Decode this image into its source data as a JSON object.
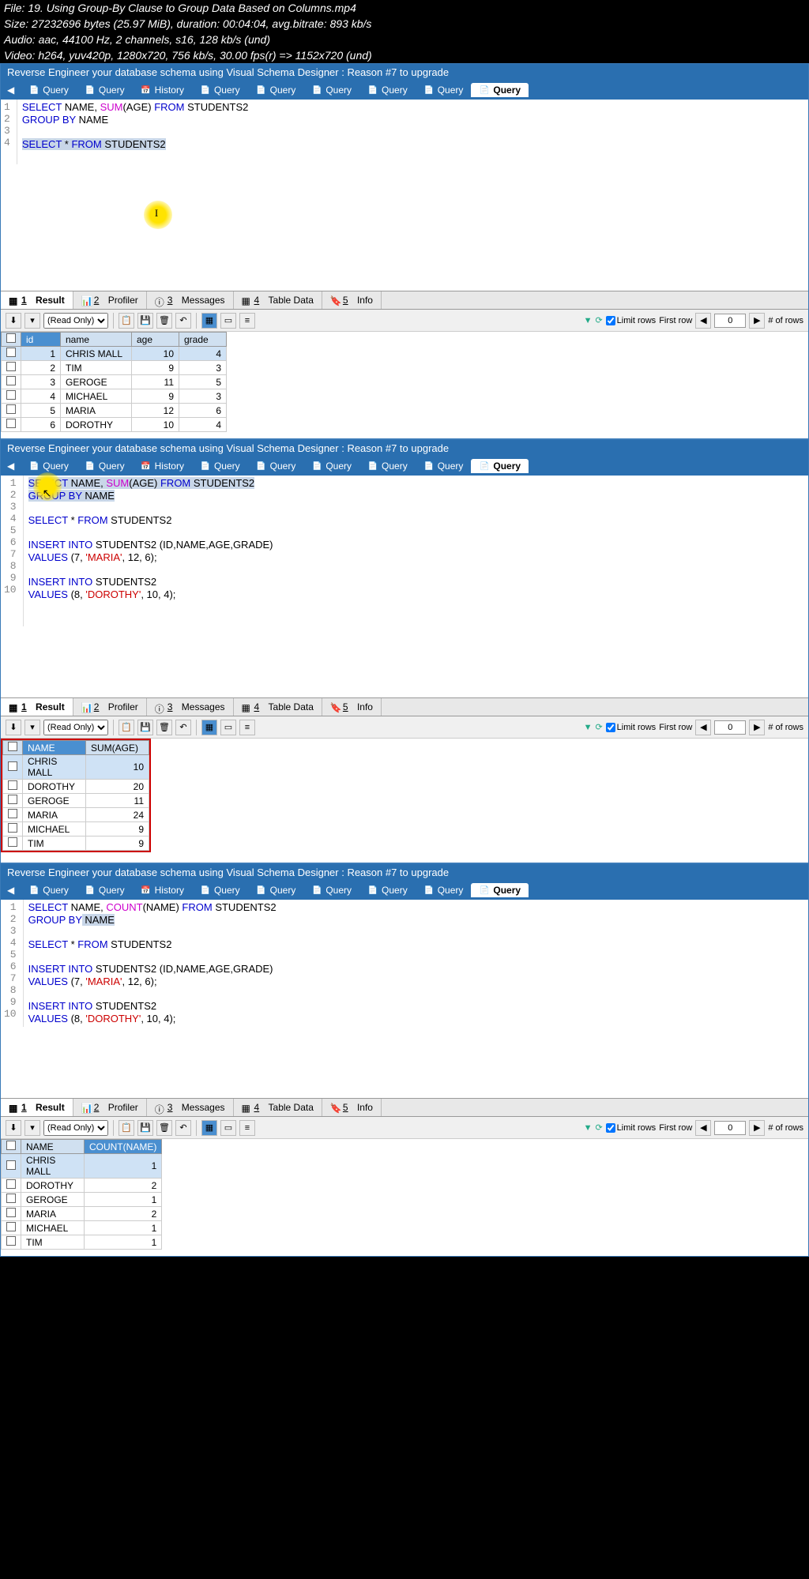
{
  "file_info": {
    "file": "File: 19. Using Group-By Clause to Group Data Based on Columns.mp4",
    "size": "Size: 27232696 bytes (25.97 MiB), duration: 00:04:04, avg.bitrate: 893 kb/s",
    "audio": "Audio: aac, 44100 Hz, 2 channels, s16, 128 kb/s (und)",
    "video": "Video: h264, yuv420p, 1280x720, 756 kb/s, 30.00 fps(r) => 1152x720 (und)"
  },
  "banner": "Reverse Engineer your database schema using Visual Schema Designer : Reason #7 to upgrade",
  "tabs": {
    "query": "Query",
    "history": "History"
  },
  "result_tabs": {
    "result": "Result",
    "profiler": "Profiler",
    "messages": "Messages",
    "table_data": "Table Data",
    "info": "Info"
  },
  "toolbar": {
    "readonly": "(Read Only)",
    "limit_rows": "Limit rows",
    "first_row": "First row",
    "first_row_val": "0",
    "num_rows": "# of rows"
  },
  "panel1": {
    "code": {
      "l1": {
        "select": "SELECT",
        "name": " NAME, ",
        "sum": "SUM",
        "rest": "(AGE) ",
        "from": "FROM",
        "tbl": " STUDENTS2"
      },
      "l2": {
        "group": "GROUP BY",
        "rest": " NAME"
      },
      "l4": {
        "select": "SELECT",
        "star": " * ",
        "from": "FROM",
        "tbl": " STUDENTS2"
      }
    },
    "cols": [
      "id",
      "name",
      "age",
      "grade"
    ],
    "rows": [
      {
        "id": "1",
        "name": "CHRIS MALL",
        "age": "10",
        "grade": "4"
      },
      {
        "id": "2",
        "name": "TIM",
        "age": "9",
        "grade": "3"
      },
      {
        "id": "3",
        "name": "GEROGE",
        "age": "11",
        "grade": "5"
      },
      {
        "id": "4",
        "name": "MICHAEL",
        "age": "9",
        "grade": "3"
      },
      {
        "id": "5",
        "name": "MARIA",
        "age": "12",
        "grade": "6"
      },
      {
        "id": "6",
        "name": "DOROTHY",
        "age": "10",
        "grade": "4"
      }
    ]
  },
  "panel2": {
    "code": {
      "l1": {
        "select": "SELECT",
        "name": " NAME, ",
        "sum": "SUM",
        "rest": "(AGE) ",
        "from": "FROM",
        "tbl": " STUDENTS2"
      },
      "l2": {
        "group": "GROUP BY",
        "rest": " NAME"
      },
      "l4": {
        "select": "SELECT",
        "star": " * ",
        "from": "FROM",
        "tbl": " STUDENTS2"
      },
      "l6": {
        "insert": "INSERT INTO",
        "tbl": " STUDENTS2 (ID,NAME,AGE,GRADE)"
      },
      "l7": {
        "values": "VALUES",
        "rest1": " (7, ",
        "str": "'MARIA'",
        "rest2": ", 12, 6);"
      },
      "l9": {
        "insert": "INSERT INTO",
        "tbl": " STUDENTS2"
      },
      "l10": {
        "values": "VALUES",
        "rest1": " (8, ",
        "str": "'DOROTHY'",
        "rest2": ", 10, 4);"
      }
    },
    "cols": [
      "NAME",
      "SUM(AGE)"
    ],
    "rows": [
      {
        "name": "CHRIS MALL",
        "sum": "10"
      },
      {
        "name": "DOROTHY",
        "sum": "20"
      },
      {
        "name": "GEROGE",
        "sum": "11"
      },
      {
        "name": "MARIA",
        "sum": "24"
      },
      {
        "name": "MICHAEL",
        "sum": "9"
      },
      {
        "name": "TIM",
        "sum": "9"
      }
    ]
  },
  "panel3": {
    "code": {
      "l1": {
        "select": "SELECT",
        "name": " NAME, ",
        "count": "COUNT",
        "rest": "(NAME) ",
        "from": "FROM",
        "tbl": " STUDENTS2"
      },
      "l2": {
        "group": "GROUP BY",
        "name": " NAME"
      },
      "l4": {
        "select": "SELECT",
        "star": " * ",
        "from": "FROM",
        "tbl": " STUDENTS2"
      },
      "l6": {
        "insert": "INSERT INTO",
        "tbl": " STUDENTS2 (ID,NAME,AGE,GRADE)"
      },
      "l7": {
        "values": "VALUES",
        "rest1": " (7, ",
        "str": "'MARIA'",
        "rest2": ", 12, 6);"
      },
      "l9": {
        "insert": "INSERT INTO",
        "tbl": " STUDENTS2"
      },
      "l10": {
        "values": "VALUES",
        "rest1": " (8, ",
        "str": "'DOROTHY'",
        "rest2": ", 10, 4);"
      }
    },
    "cols": [
      "NAME",
      "COUNT(NAME)"
    ],
    "rows": [
      {
        "name": "CHRIS MALL",
        "count": "1"
      },
      {
        "name": "DOROTHY",
        "count": "2"
      },
      {
        "name": "GEROGE",
        "count": "1"
      },
      {
        "name": "MARIA",
        "count": "2"
      },
      {
        "name": "MICHAEL",
        "count": "1"
      },
      {
        "name": "TIM",
        "count": "1"
      }
    ]
  }
}
